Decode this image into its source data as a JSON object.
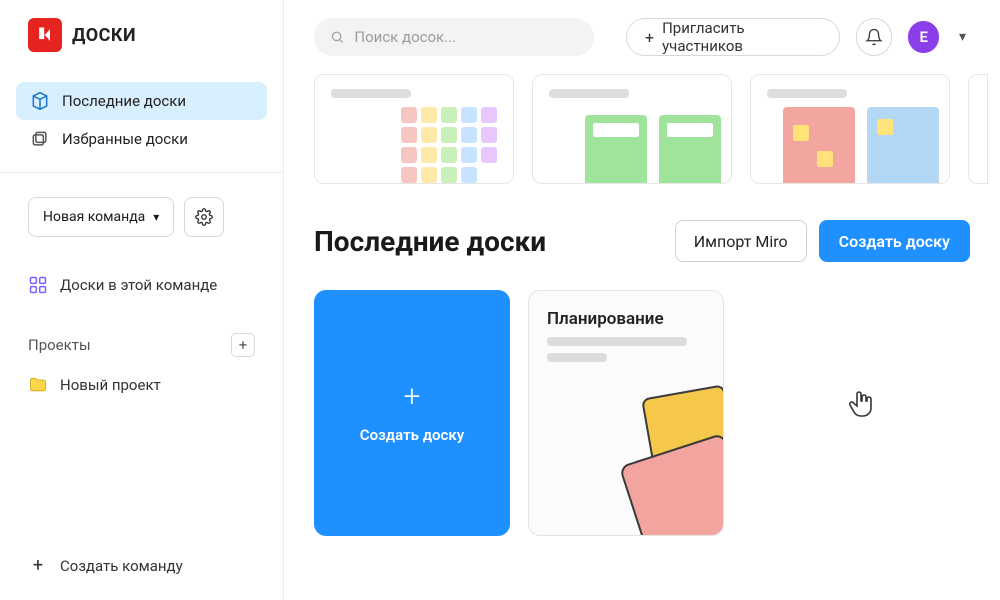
{
  "brand": {
    "title": "ДОСКИ"
  },
  "sidebar": {
    "nav": [
      {
        "label": "Последние доски",
        "active": true
      },
      {
        "label": "Избранные доски",
        "active": false
      }
    ],
    "team_selector": {
      "label": "Новая команда"
    },
    "team_boards_label": "Доски в этой команде",
    "projects_heading": "Проекты",
    "projects": [
      {
        "label": "Новый проект"
      }
    ],
    "create_team_label": "Создать команду"
  },
  "topbar": {
    "search_placeholder": "Поиск досок...",
    "invite_label": "Пригласить участников",
    "avatar_initial": "E"
  },
  "section": {
    "title": "Последние доски",
    "import_button": "Импорт Miro",
    "create_button": "Создать доску"
  },
  "boards": {
    "create_tile_label": "Создать доску",
    "items": [
      {
        "title": "Планирование"
      }
    ]
  },
  "colors": {
    "primary": "#1e90ff",
    "brand_red": "#e52421",
    "avatar": "#8a3fea"
  }
}
